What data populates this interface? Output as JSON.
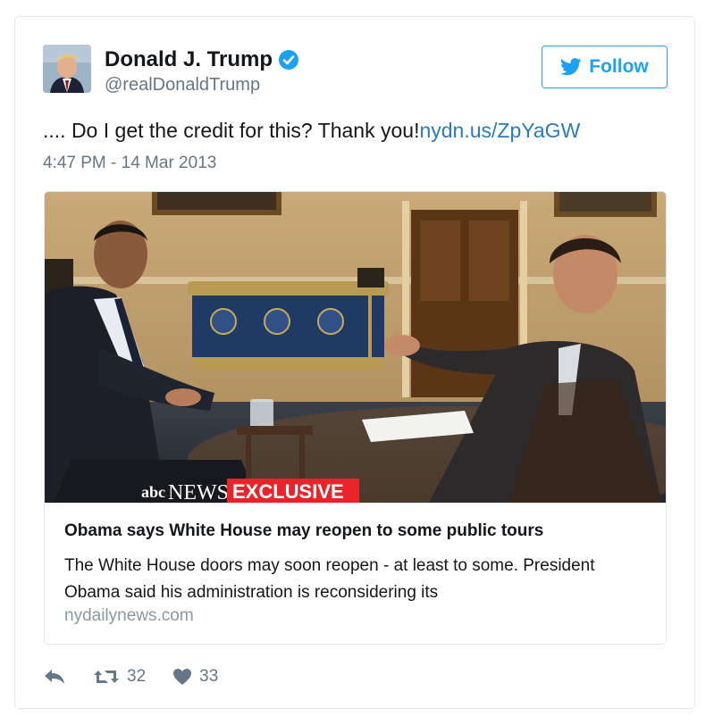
{
  "author": {
    "name": "Donald J. Trump",
    "handle": "@realDonaldTrump",
    "verified": true
  },
  "follow_button": {
    "label": "Follow"
  },
  "tweet": {
    "text": ".... Do I get the credit for this? Thank you!",
    "link": "nydn.us/ZpYaGW",
    "timestamp": "4:47 PM - 14 Mar 2013"
  },
  "card": {
    "image_overlay": {
      "brand": "NEWS",
      "tag": "EXCLUSIVE"
    },
    "title": "Obama says White House may reopen to some public tours",
    "description": "The White House doors may soon reopen - at least to some. President Obama said his administration is reconsidering its",
    "domain": "nydailynews.com"
  },
  "actions": {
    "retweets": "32",
    "likes": "33"
  },
  "colors": {
    "accent": "#1da1f2",
    "link": "#2b7bb9",
    "secondary_text": "#657786",
    "border": "#e1e8ed",
    "exclusive_banner": "#e8242a"
  }
}
